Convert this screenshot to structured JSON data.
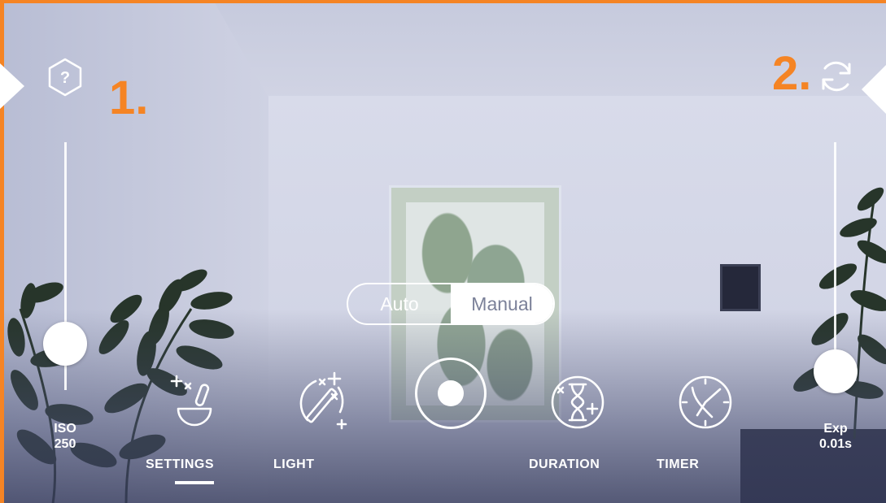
{
  "annotations": {
    "one": "1.",
    "two": "2."
  },
  "sliders": {
    "iso": {
      "label": "ISO",
      "value": "250"
    },
    "exposure": {
      "label": "Exp",
      "value": "0.01s"
    }
  },
  "mode_toggle": {
    "options": [
      "Auto",
      "Manual"
    ],
    "selected": "Manual"
  },
  "tools": [
    {
      "label": "SETTINGS",
      "icon": "mortar-pestle-icon",
      "active": true
    },
    {
      "label": "LIGHT",
      "icon": "magic-wand-icon",
      "active": false
    },
    {
      "label": "DURATION",
      "icon": "hourglass-icon",
      "active": false
    },
    {
      "label": "TIMER",
      "icon": "clock-icon",
      "active": false
    }
  ],
  "buttons": {
    "help": "help-icon",
    "rotate": "rotate-camera-icon",
    "shutter": "shutter-button"
  },
  "colors": {
    "accent": "#f58424",
    "ui_foreground": "#ffffff",
    "manual_text": "#7b8199"
  }
}
